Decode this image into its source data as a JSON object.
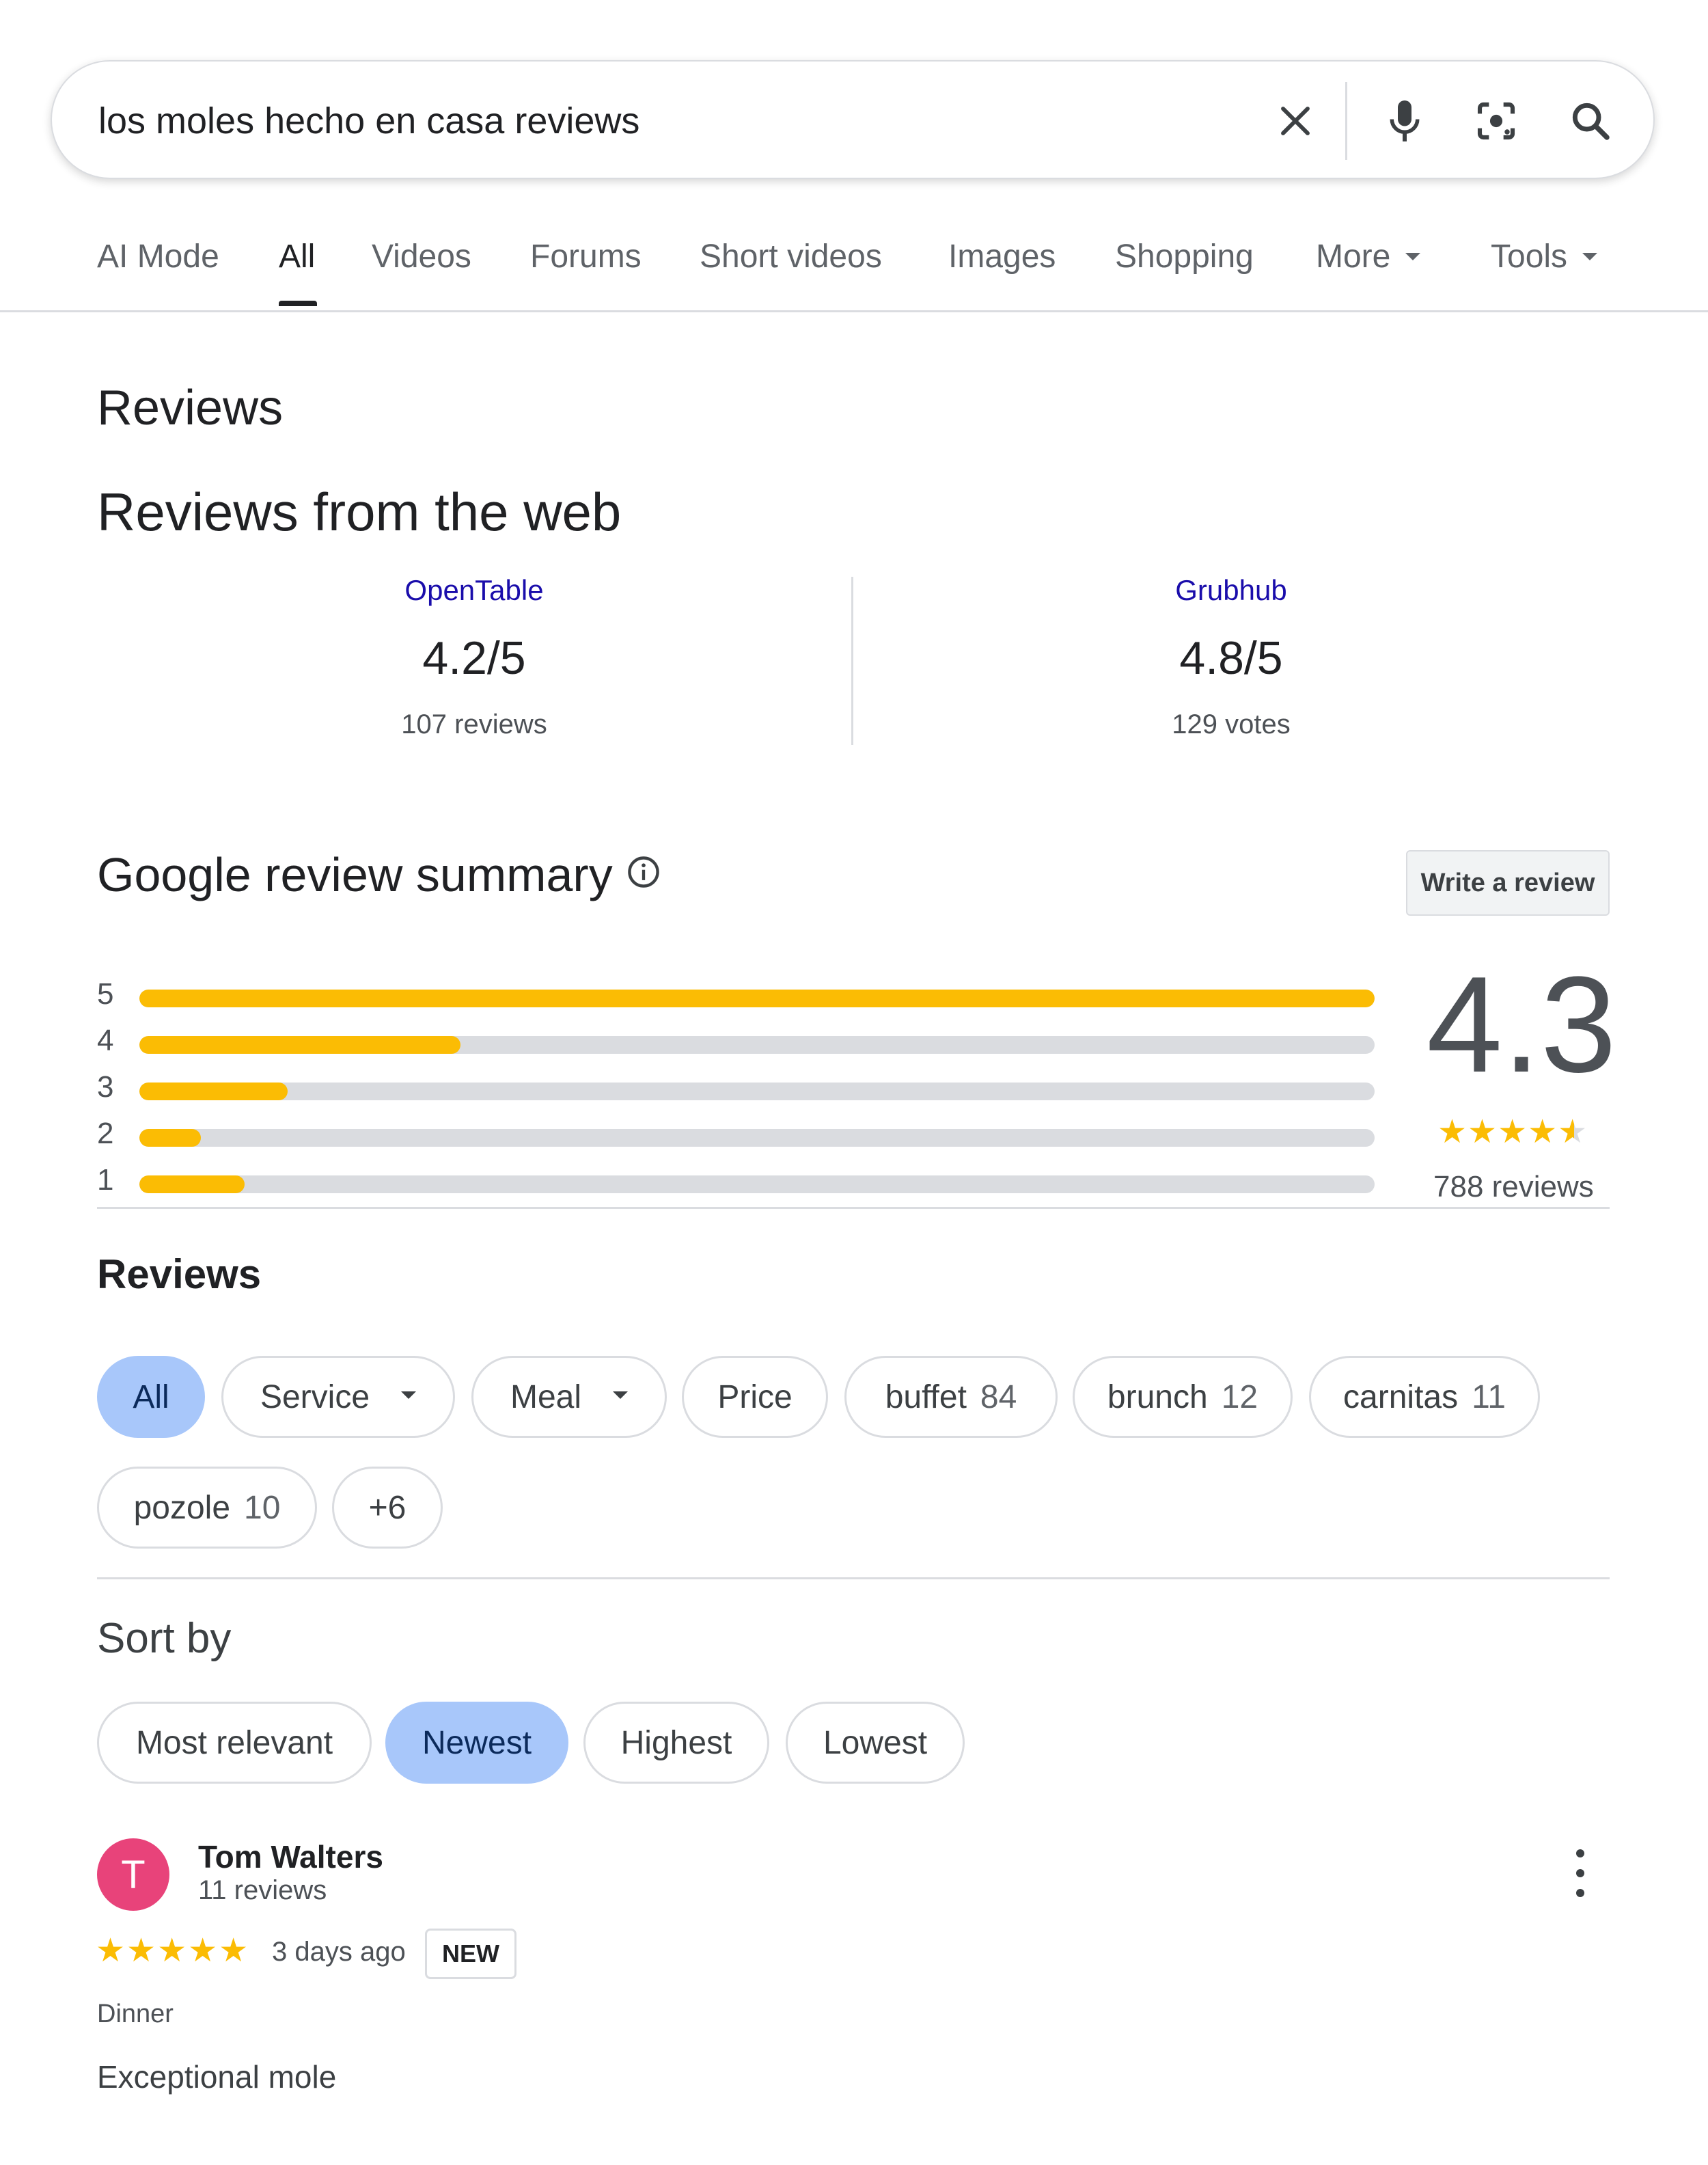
{
  "search": {
    "query": "los moles hecho en casa reviews",
    "icons": [
      "close-icon",
      "microphone-icon",
      "lens-icon",
      "search-icon"
    ]
  },
  "tabs": [
    {
      "label": "AI Mode"
    },
    {
      "label": "All",
      "active": true
    },
    {
      "label": "Videos"
    },
    {
      "label": "Forums"
    },
    {
      "label": "Short videos"
    },
    {
      "label": "Images"
    },
    {
      "label": "Shopping"
    },
    {
      "label": "More"
    },
    {
      "label": "Tools"
    }
  ],
  "page": {
    "reviews_heading": "Reviews",
    "web_heading": "Reviews from the web"
  },
  "web_sources": [
    {
      "name": "OpenTable",
      "score": "4.2/5",
      "count": "107 reviews"
    },
    {
      "name": "Grubhub",
      "score": "4.8/5",
      "count": "129 votes"
    }
  ],
  "summary": {
    "title": "Google review summary",
    "write_review": "Write a review",
    "rating": "4.3",
    "rating_value": 4.3,
    "review_count": "788 reviews",
    "distribution": [
      {
        "label": "5",
        "fraction": 1.0
      },
      {
        "label": "4",
        "fraction": 0.26
      },
      {
        "label": "3",
        "fraction": 0.12
      },
      {
        "label": "2",
        "fraction": 0.05
      },
      {
        "label": "1",
        "fraction": 0.085
      }
    ],
    "colors": {
      "bar_fill": "#fbbc04",
      "bar_track": "#dadce0"
    }
  },
  "reviews_filter": {
    "heading": "Reviews",
    "chips": [
      {
        "label": "All",
        "selected": true
      },
      {
        "label": "Service",
        "dropdown": true
      },
      {
        "label": "Meal",
        "dropdown": true
      },
      {
        "label": "Price"
      },
      {
        "label": "buffet",
        "count": "84"
      },
      {
        "label": "brunch",
        "count": "12"
      },
      {
        "label": "carnitas",
        "count": "11"
      },
      {
        "label": "pozole",
        "count": "10"
      },
      {
        "label": "+6"
      }
    ]
  },
  "sort": {
    "heading": "Sort by",
    "options": [
      {
        "label": "Most relevant"
      },
      {
        "label": "Newest",
        "selected": true
      },
      {
        "label": "Highest"
      },
      {
        "label": "Lowest"
      }
    ],
    "selected_color": "#a8c7fa"
  },
  "review": {
    "avatar_letter": "T",
    "avatar_color": "#e8437a",
    "author": "Tom Walters",
    "author_reviews": "11 reviews",
    "stars": "★★★★★",
    "rating": 5,
    "date": "3 days ago",
    "badge": "NEW",
    "meal": "Dinner",
    "text": "Exceptional mole"
  }
}
